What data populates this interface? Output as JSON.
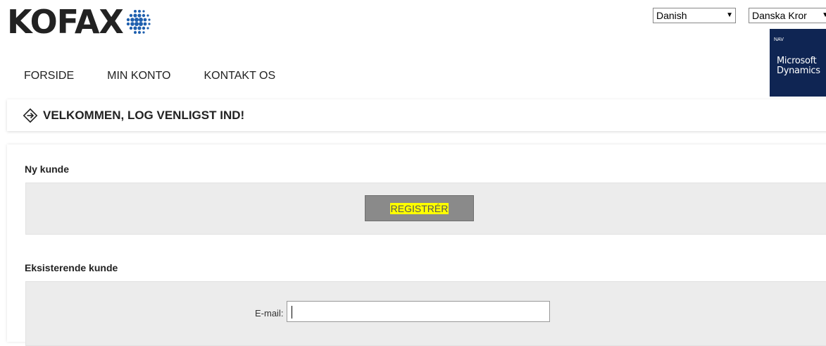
{
  "header": {
    "logo_text": "KOFAX",
    "language_select": {
      "value": "Danish"
    },
    "currency_select": {
      "value": "Danska Kror"
    },
    "nav_badge": {
      "small_text": "NAV",
      "line1": "Microsoft",
      "line2": "Dynamics",
      "color": "#0f2553"
    }
  },
  "menu": {
    "items": [
      "FORSIDE",
      "MIN KONTO",
      "KONTAKT OS"
    ]
  },
  "welcome": {
    "title": "VELKOMMEN, LOG VENLIGST IND!",
    "icon": "arrow-circle-icon"
  },
  "new_customer": {
    "title": "Ny kunde",
    "register_label": "REGISTRÉR",
    "highlight_color": "#ffff00"
  },
  "existing_customer": {
    "title": "Eksisterende kunde",
    "email_label": "E-mail:",
    "email_value": ""
  }
}
